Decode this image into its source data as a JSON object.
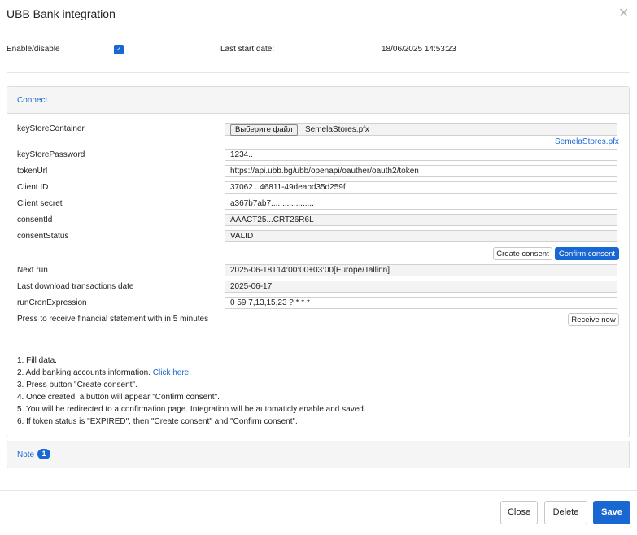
{
  "window": {
    "title": "UBB Bank integration",
    "close_icon": "close-icon"
  },
  "top": {
    "enable_label": "Enable/disable",
    "enabled": true,
    "last_start_label": "Last start date:",
    "last_start_value": "18/06/2025 14:53:23"
  },
  "connect": {
    "title": "Connect",
    "keystore_container": {
      "label": "keyStoreContainer",
      "button": "Выберите файл",
      "file_name": "SemelaStores.pfx",
      "link": "SemelaStores.pfx"
    },
    "keystore_password": {
      "label": "keyStorePassword",
      "value": "1234.."
    },
    "token_url": {
      "label": "tokenUrl",
      "value": "https://api.ubb.bg/ubb/openapi/oauther/oauth2/token"
    },
    "client_id": {
      "label": "Client ID",
      "value": "37062...46811-49deabd35d259f"
    },
    "client_secret": {
      "label": "Client secret",
      "value": "a367b7ab7..................."
    },
    "consent_id": {
      "label": "consentId",
      "value": "AAACT25...CRT26R6L"
    },
    "consent_status": {
      "label": "consentStatus",
      "value": "VALID"
    },
    "create_consent": "Create consent",
    "confirm_consent": "Confirm consent",
    "next_run": {
      "label": "Next run",
      "value": "2025-06-18T14:00:00+03:00[Europe/Tallinn]"
    },
    "last_download": {
      "label": "Last download transactions date",
      "value": "2025-06-17"
    },
    "cron": {
      "label": "runCronExpression",
      "value": "0 59 7,13,15,23 ? * * *"
    },
    "press_text": "Press to receive financial statement with in 5 minutes",
    "receive_now": "Receive now",
    "instructions": {
      "step1": "1. Fill data.",
      "step2_prefix": "2. Add banking accounts information. ",
      "step2_link": "Click here.",
      "step3": "3. Press button \"Create consent\".",
      "step4": "4. Once created, a button will appear \"Confirm consent\".",
      "step5": "5. You will be redirected to a confirmation page. Integration will be automaticly enable and saved.",
      "step6": "6. If token status is \"EXPIRED\", then \"Create consent\" and \"Confirm consent\"."
    }
  },
  "note": {
    "title": "Note",
    "count": "1"
  },
  "footer": {
    "close": "Close",
    "delete": "Delete",
    "save": "Save"
  },
  "colors": {
    "accent": "#1967d2",
    "panel_bg": "#f5f5f5",
    "border": "#dcdcdc"
  }
}
